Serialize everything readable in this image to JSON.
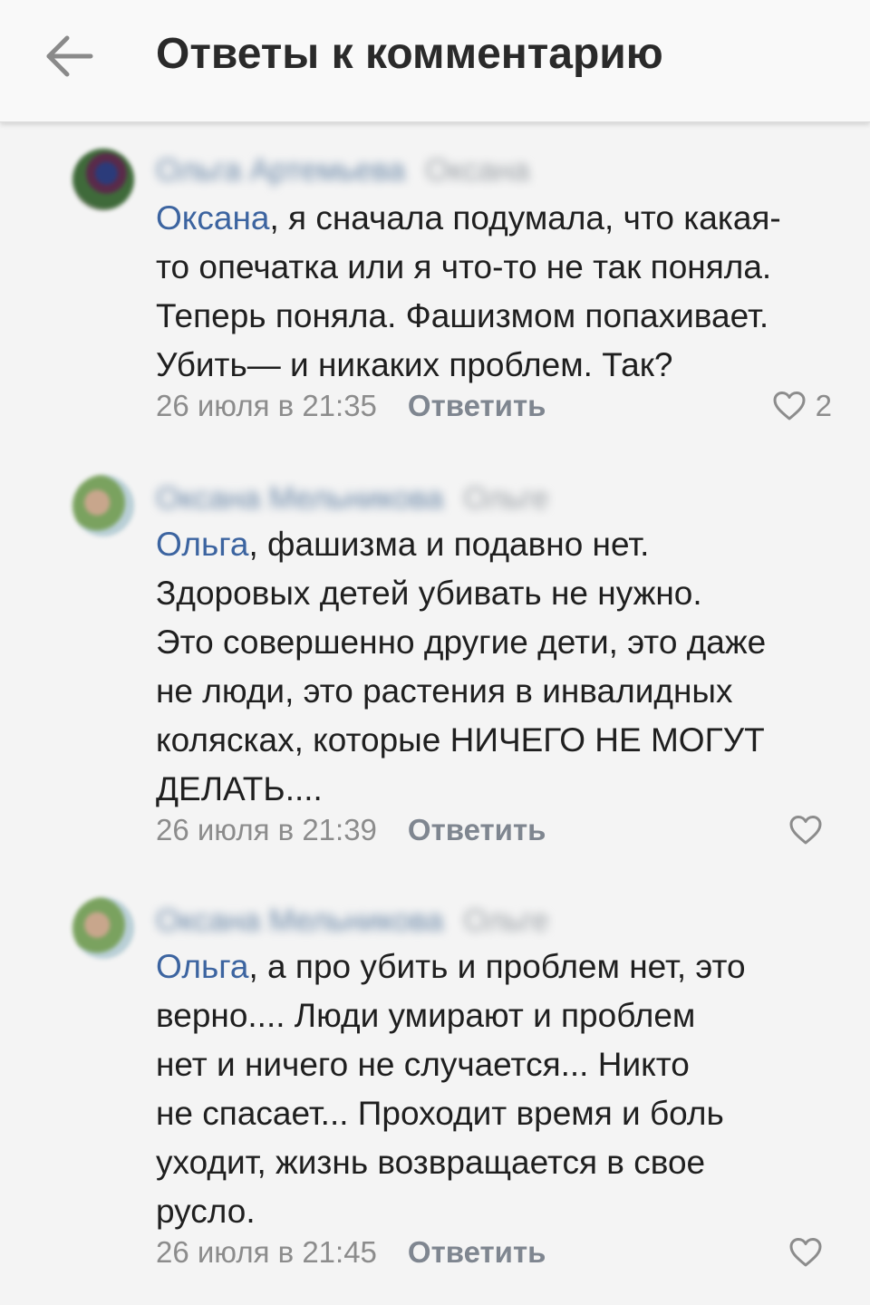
{
  "header": {
    "title": "Ответы к комментарию",
    "back_icon": "arrow-left-icon"
  },
  "colors": {
    "mention": "#3c64a0",
    "meta": "#8c8c8c",
    "text": "#1f1f1f"
  },
  "comments": [
    {
      "author": "Ольга Артемьева",
      "reply_to": "Оксана",
      "mention": "Оксана",
      "lines": [
        ", я сначала подумала, что какая-",
        "то опечатка или я что-то не так поняла.",
        "Теперь поняла. Фашизмом попахивает.",
        "Убить— и никаких проблем. Так?"
      ],
      "time": "26 июля в 21:35",
      "reply_label": "Ответить",
      "likes": "2"
    },
    {
      "author": "Оксана Мельникова",
      "reply_to": "Ольге",
      "mention": "Ольга",
      "lines": [
        ", фашизма и подавно нет.",
        "Здоровых детей убивать не нужно.",
        "Это совершенно другие дети, это даже",
        "не люди, это растения в инвалидных",
        "колясках, которые НИЧЕГО НЕ МОГУТ",
        "ДЕЛАТЬ...."
      ],
      "time": "26 июля в 21:39",
      "reply_label": "Ответить",
      "likes": ""
    },
    {
      "author": "Оксана Мельникова",
      "reply_to": "Ольге",
      "mention": "Ольга",
      "lines": [
        ", а про убить и проблем нет, это",
        "верно.... Люди умирают и проблем",
        "нет и ничего не случается... Никто",
        "не спасает... Проходит время и боль",
        "уходит, жизнь возвращается в свое",
        "русло."
      ],
      "time": "26 июля в 21:45",
      "reply_label": "Ответить",
      "likes": ""
    }
  ]
}
